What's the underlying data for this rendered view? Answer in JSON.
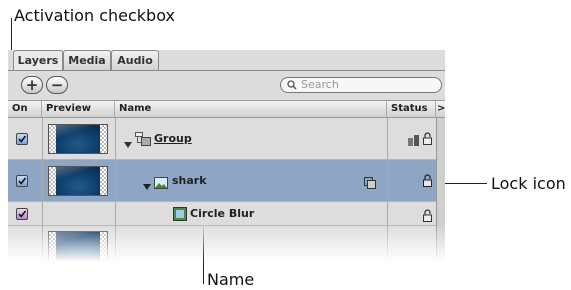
{
  "callouts": {
    "activation": "Activation checkbox",
    "lock": "Lock icon",
    "name": "Name"
  },
  "tabs": [
    {
      "label": "Layers",
      "active": true
    },
    {
      "label": "Media",
      "active": false
    },
    {
      "label": "Audio",
      "active": false
    }
  ],
  "toolbar": {
    "add_label": "+",
    "remove_label": "−",
    "search_placeholder": "Search"
  },
  "columns": {
    "on": "On",
    "preview": "Preview",
    "name": "Name",
    "status": "Status",
    "expand": ">"
  },
  "rows": [
    {
      "name": "Group",
      "checked": true,
      "has_preview": true,
      "icon": "group-icon",
      "selected": false
    },
    {
      "name": "shark",
      "checked": true,
      "has_preview": true,
      "icon": "image-layer-icon",
      "selected": true
    },
    {
      "name": "Circle Blur",
      "checked": true,
      "has_preview": false,
      "icon": "filter-icon",
      "selected": false
    }
  ],
  "colors": {
    "selected_row": "#8ea5c4",
    "panel_bg": "#dcdcdc",
    "checkbox": "#7fa0de"
  }
}
